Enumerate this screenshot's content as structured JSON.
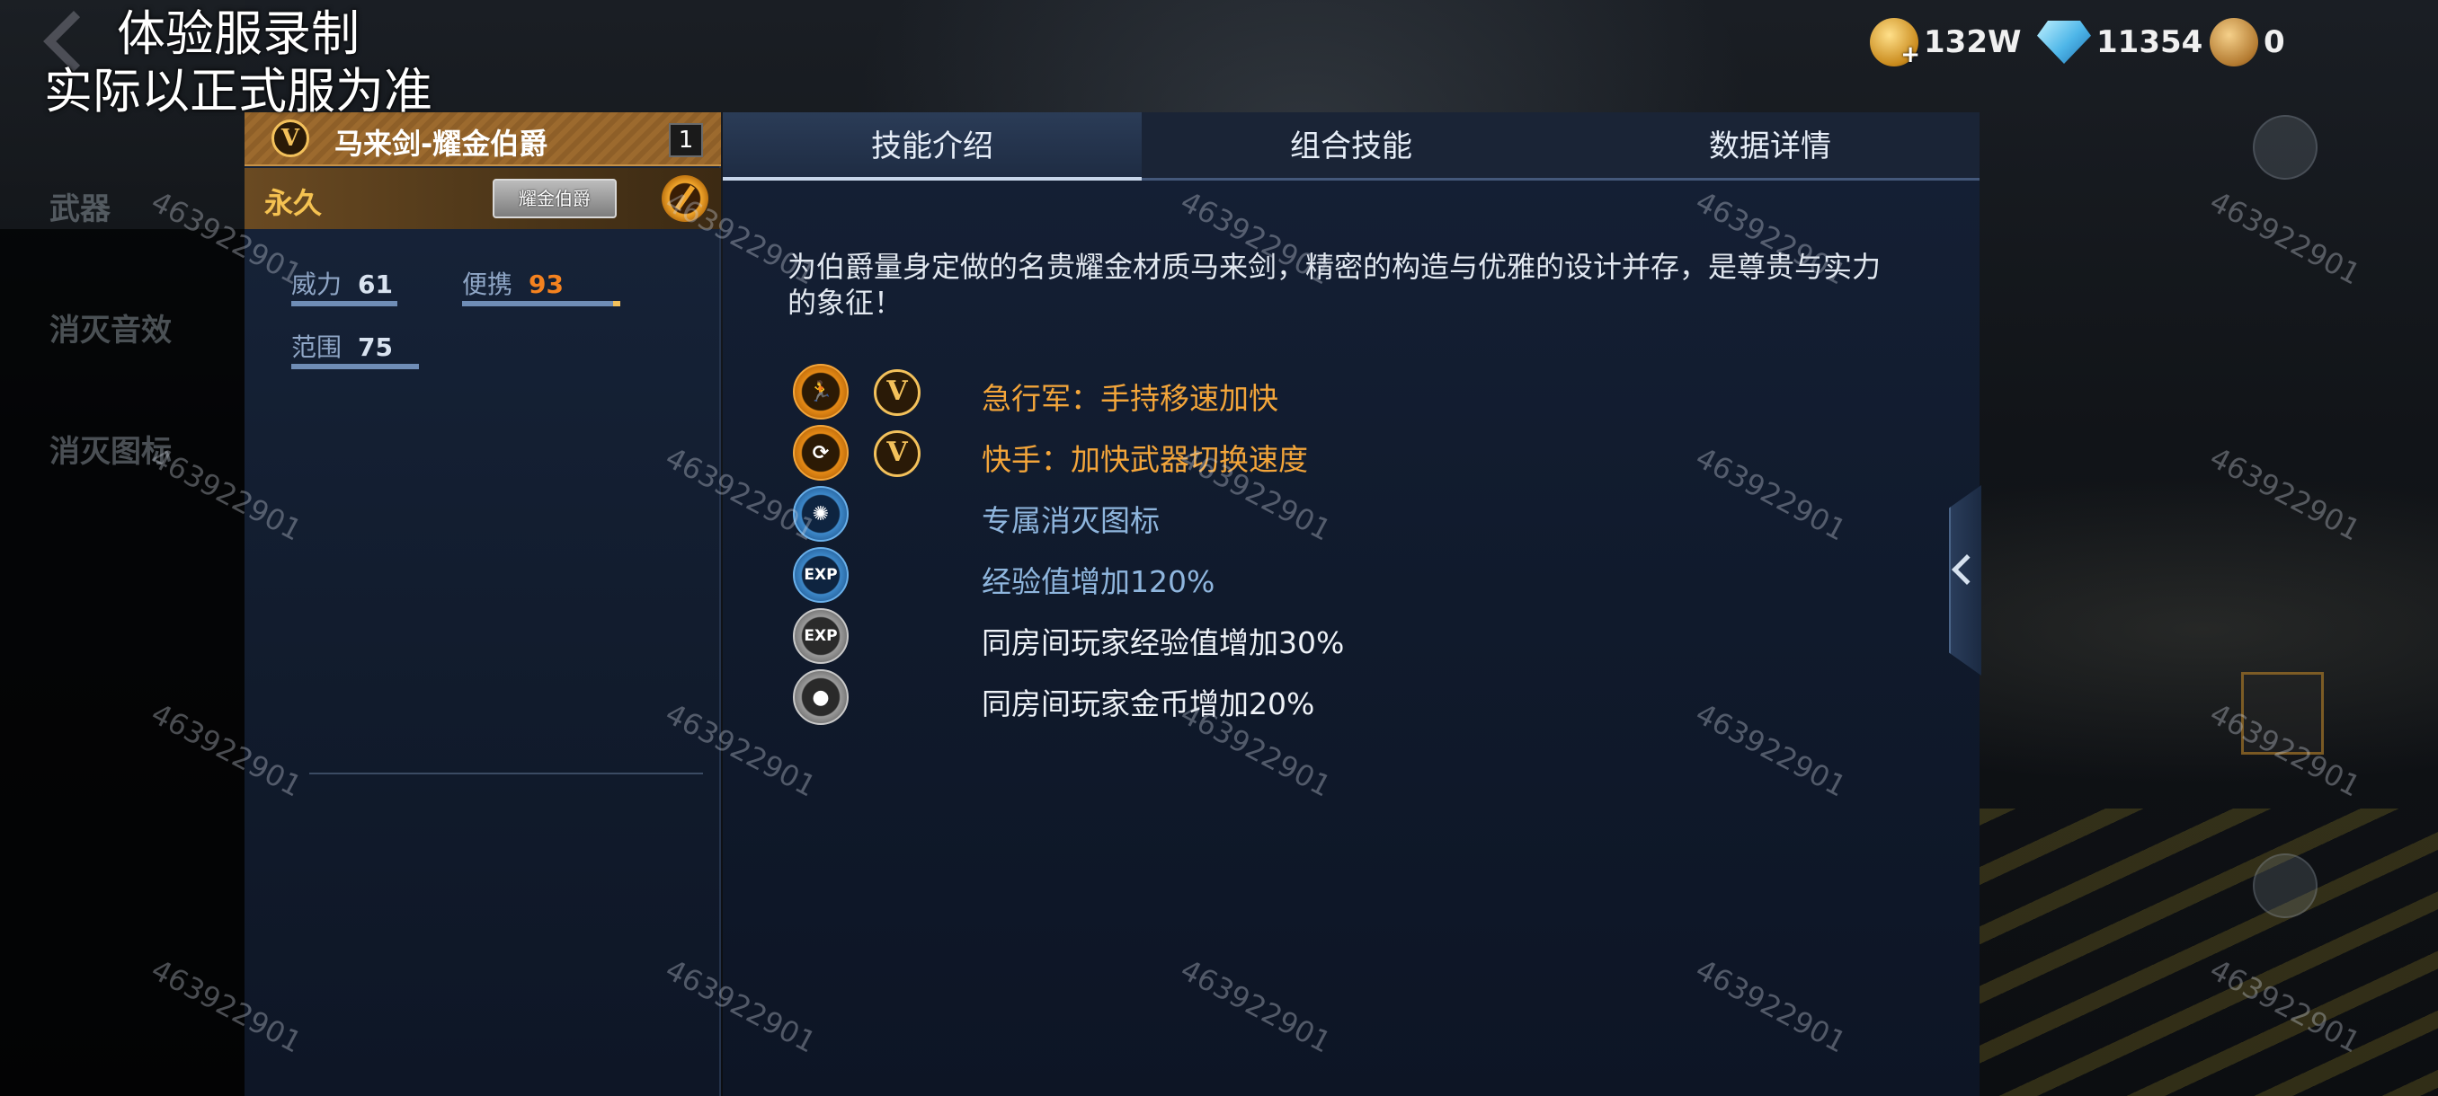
{
  "recording_note": {
    "line1": "体验服录制",
    "line2": "实际以正式服为准"
  },
  "background_menu": [
    "武器",
    "消灭音效",
    "消灭图标"
  ],
  "currencies": [
    {
      "icon": "gold-coin-icon",
      "value": "132W"
    },
    {
      "icon": "diamond-icon",
      "value": "11354"
    },
    {
      "icon": "medal-coin-icon",
      "value": "0"
    }
  ],
  "weapon": {
    "name": "马来剑-耀金伯爵",
    "count": "1",
    "duration": "永久",
    "title_badge": "耀金伯爵",
    "tier_badge": "V",
    "stats": [
      {
        "label": "威力",
        "value": "61",
        "color": "#d9e3f0"
      },
      {
        "label": "便携",
        "value": "93",
        "color": "#f4821f"
      },
      {
        "label": "范围",
        "value": "75",
        "color": "#d9e3f0"
      }
    ]
  },
  "tabs": [
    "技能介绍",
    "组合技能",
    "数据详情"
  ],
  "active_tab": 0,
  "description": "为伯爵量身定做的名贵耀金材质马来剑，精密的构造与优雅的设计并存，是尊贵与实力的象征！",
  "skills": [
    {
      "icon": "sprint-icon",
      "tier": "V",
      "text": "急行军：手持移速加快",
      "style": "orange"
    },
    {
      "icon": "quick-hand-icon",
      "tier": "V",
      "text": "快手：加快武器切换速度",
      "style": "orange"
    },
    {
      "icon": "kill-icon-badge-icon",
      "tier": "",
      "text": "专属消灭图标",
      "style": "blue"
    },
    {
      "icon": "exp-boost-icon",
      "tier": "",
      "text": "经验值增加120%",
      "style": "blue"
    },
    {
      "icon": "room-exp-icon",
      "tier": "",
      "text": "同房间玩家经验值增加30%",
      "style": "white"
    },
    {
      "icon": "room-coin-icon",
      "tier": "",
      "text": "同房间玩家金币增加20%",
      "style": "white"
    }
  ],
  "watermark": "463922901",
  "colors": {
    "accent_orange": "#f3a53a",
    "accent_blue": "#8fb6de",
    "gold": "#f5c251"
  }
}
